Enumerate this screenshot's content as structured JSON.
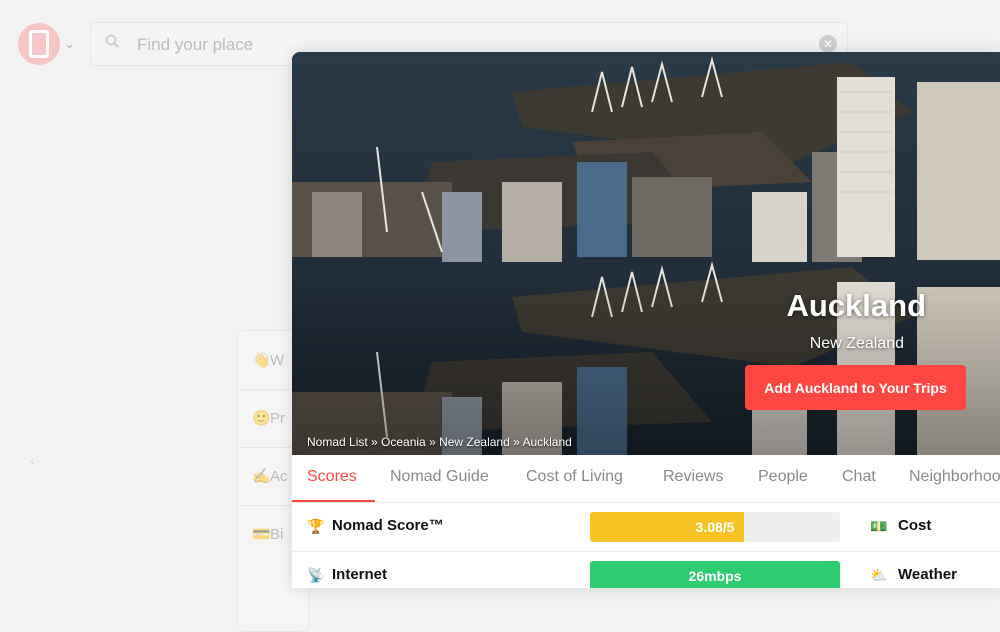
{
  "header": {
    "search": {
      "placeholder": "Find your place"
    }
  },
  "side_menu": {
    "items": [
      {
        "label": "W",
        "icon": "wave-icon"
      },
      {
        "label": "Pr",
        "icon": "smile-icon"
      },
      {
        "label": "Ac",
        "icon": "pencil-icon"
      },
      {
        "label": "Bi",
        "icon": "card-icon"
      }
    ]
  },
  "city": {
    "name": "Auckland",
    "country": "New Zealand",
    "add_button": "Add Auckland to Your Trips",
    "breadcrumb": "Nomad List » Oceania » New Zealand » Auckland"
  },
  "tabs": [
    {
      "label": "Scores",
      "active": true
    },
    {
      "label": "Nomad Guide"
    },
    {
      "label": "Cost of Living"
    },
    {
      "label": "Reviews"
    },
    {
      "label": "People"
    },
    {
      "label": "Chat"
    },
    {
      "label": "Neighborhoo"
    }
  ],
  "scores": [
    {
      "icon": "trophy-icon",
      "label": "Nomad Score™",
      "value_text": "3.08/5",
      "fraction": 0.616,
      "color": "#f7c325",
      "right_icon": "money-icon",
      "right_label": "Cost"
    },
    {
      "icon": "satellite-icon",
      "label": "Internet",
      "value_text": "26mbps",
      "fraction": 1.0,
      "color": "#2ecc71",
      "right_icon": "cloud-icon",
      "right_label": "Weather"
    }
  ],
  "colors": {
    "accent": "#ff4742",
    "score_yellow": "#f7c325",
    "score_green": "#2ecc71"
  }
}
